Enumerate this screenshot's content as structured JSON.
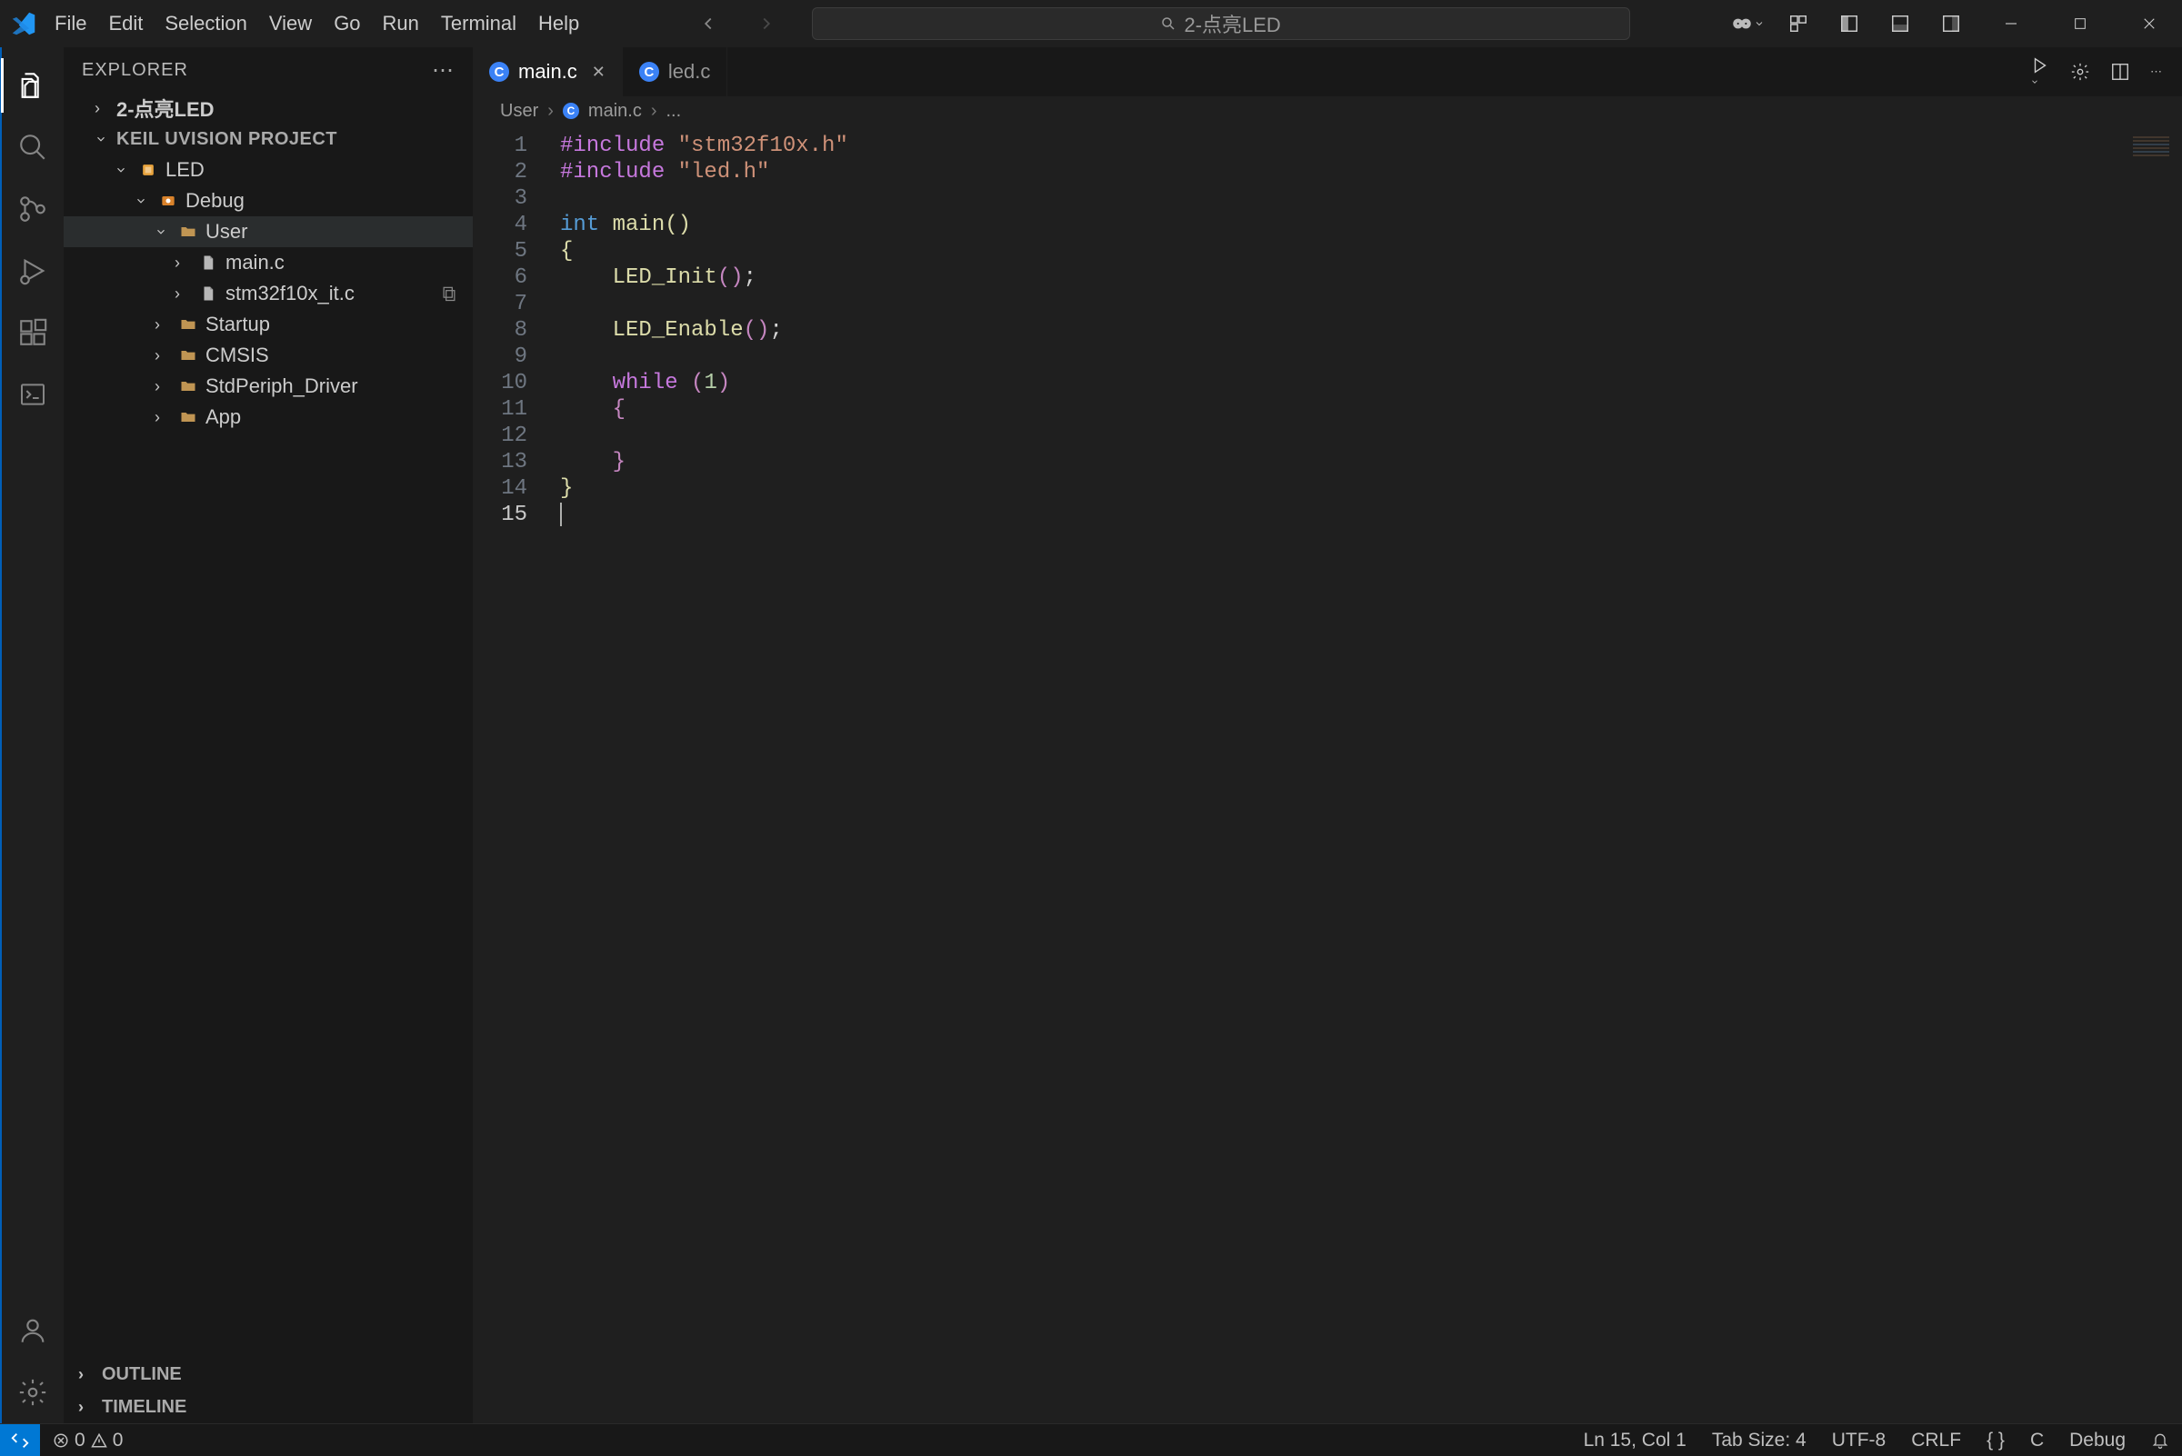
{
  "menu": {
    "items": [
      "File",
      "Edit",
      "Selection",
      "View",
      "Go",
      "Run",
      "Terminal",
      "Help"
    ]
  },
  "search": {
    "placeholder": "2-点亮LED"
  },
  "sidebar": {
    "title": "EXPLORER",
    "project_root": "2-点亮LED",
    "section_title": "KEIL UVISION PROJECT",
    "tree": {
      "led": "LED",
      "debug": "Debug",
      "user": "User",
      "main_c": "main.c",
      "stm32": "stm32f10x_it.c",
      "startup": "Startup",
      "cmsis": "CMSIS",
      "stdperiph": "StdPeriph_Driver",
      "app": "App"
    },
    "outline": "OUTLINE",
    "timeline": "TIMELINE"
  },
  "tabs": [
    {
      "name": "main.c",
      "active": true
    },
    {
      "name": "led.c",
      "active": false
    }
  ],
  "breadcrumbs": {
    "parts": [
      "User",
      "main.c",
      "..."
    ]
  },
  "code": {
    "lines": 15,
    "line1_a": "#include",
    "line1_b": "\"stm32f10x.h\"",
    "line2_a": "#include",
    "line2_b": "\"led.h\"",
    "line4_a": "int",
    "line4_b": "main",
    "line6": "LED_Init",
    "line8": "LED_Enable",
    "line10_a": "while",
    "line10_b": "1"
  },
  "status": {
    "errors": "0",
    "warnings": "0",
    "ln_col": "Ln 15, Col 1",
    "tab_size": "Tab Size: 4",
    "encoding": "UTF-8",
    "eol": "CRLF",
    "lang": "C",
    "debug": "Debug",
    "braces": "{ }"
  }
}
